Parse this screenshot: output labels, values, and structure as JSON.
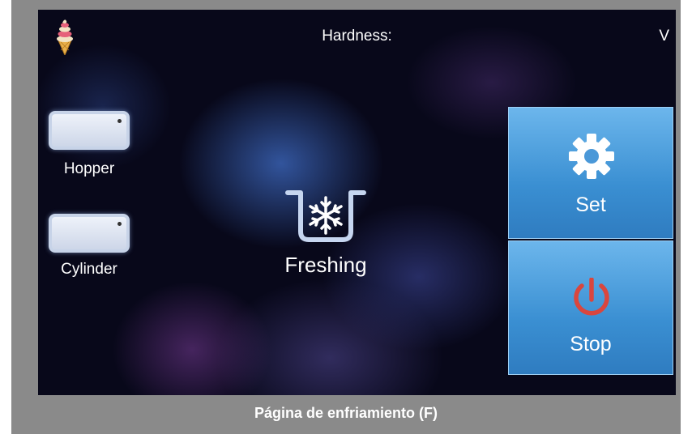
{
  "header": {
    "hardness_label": "Hardness:",
    "hardness_value": "V",
    "logo_icon": "ice-cream-cone-icon"
  },
  "gauges": [
    {
      "label": "Hopper",
      "icon": "hopper-level-icon"
    },
    {
      "label": "Cylinder",
      "icon": "cylinder-level-icon"
    }
  ],
  "status": {
    "label": "Freshing",
    "icon": "snowflake-tank-icon"
  },
  "buttons": {
    "set": {
      "label": "Set",
      "icon": "gear-icon",
      "icon_color": "#ffffff"
    },
    "stop": {
      "label": "Stop",
      "icon": "power-icon",
      "icon_color": "#d9463e"
    }
  },
  "caption": "Página de enfriamiento (F)",
  "colors": {
    "button_top": "#6cb6ec",
    "button_bottom": "#2f7cc0",
    "frame": "#8a8a8a",
    "stop_icon": "#d9463e"
  }
}
